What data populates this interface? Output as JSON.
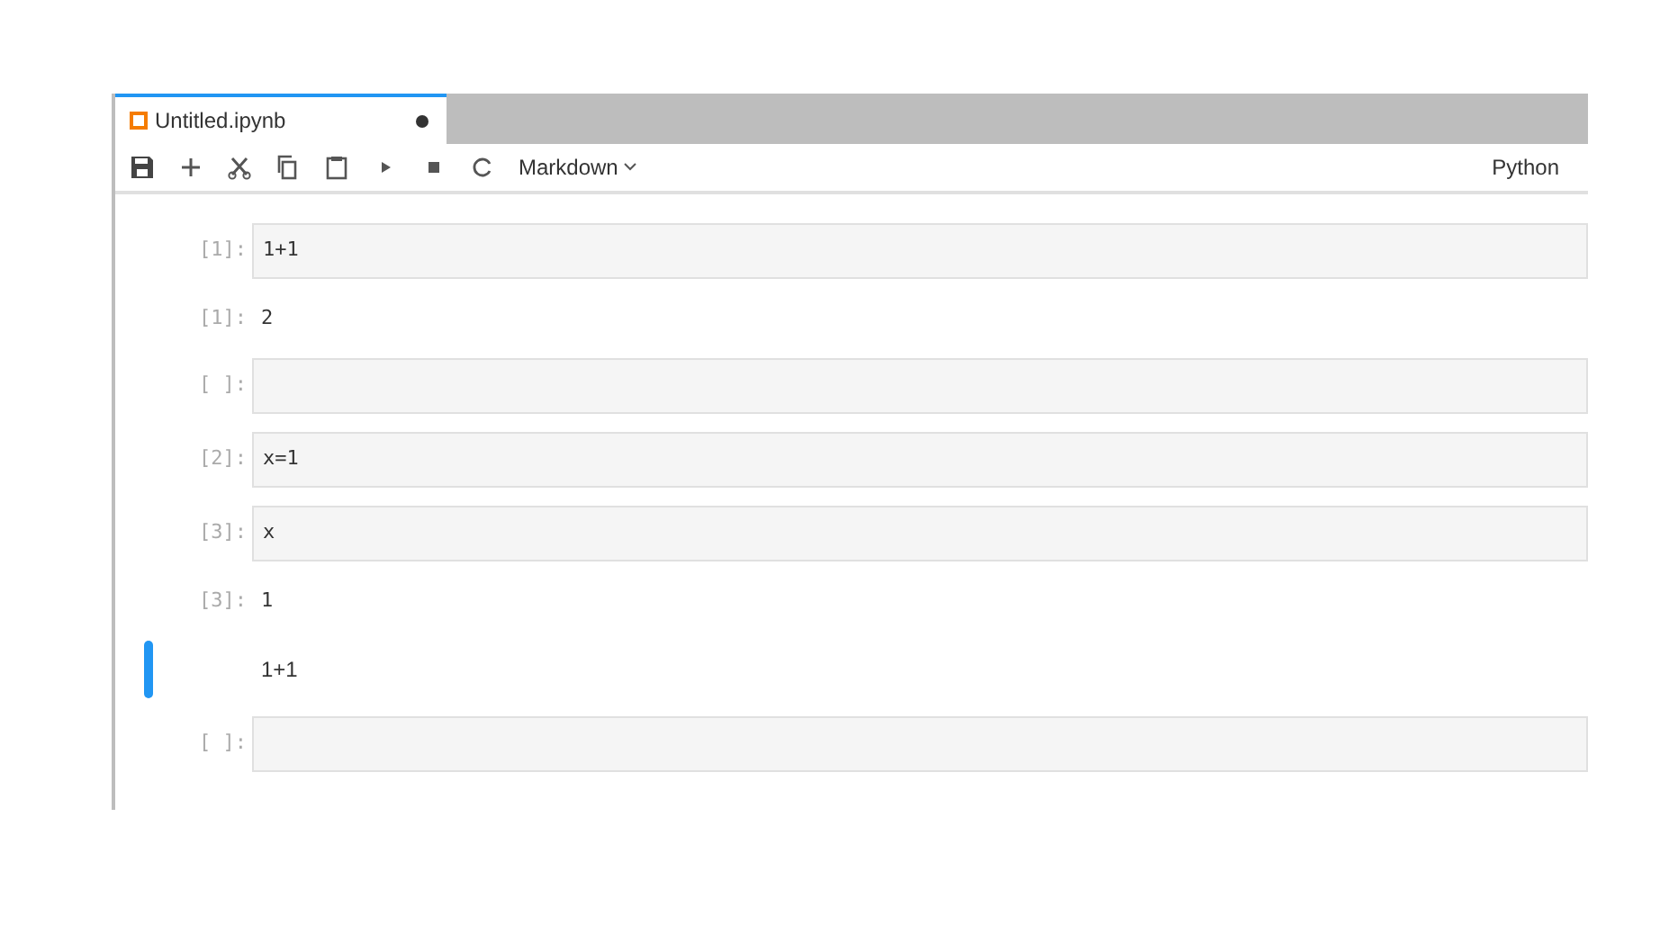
{
  "tab": {
    "title": "Untitled.ipynb",
    "dirty": true,
    "selected": true
  },
  "toolbar": {
    "cell_type": "Markdown",
    "kernel": "Python"
  },
  "cells": [
    {
      "kind": "input",
      "prompt": "[1]:",
      "code": "1+1",
      "selected": false
    },
    {
      "kind": "output",
      "prompt": "[1]:",
      "text": "2"
    },
    {
      "kind": "input",
      "prompt": "[ ]:",
      "selected": false
    },
    {
      "kind": "input",
      "prompt": "[2]:",
      "code": "x=1",
      "selected": false
    },
    {
      "kind": "input",
      "prompt": "[3]:",
      "code": "x",
      "selected": false
    },
    {
      "kind": "output",
      "prompt": "[3]:",
      "text": "1"
    },
    {
      "kind": "markdown",
      "text": "1+1",
      "selected": true
    },
    {
      "kind": "input",
      "prompt": "[ ]:",
      "selected": false
    }
  ]
}
